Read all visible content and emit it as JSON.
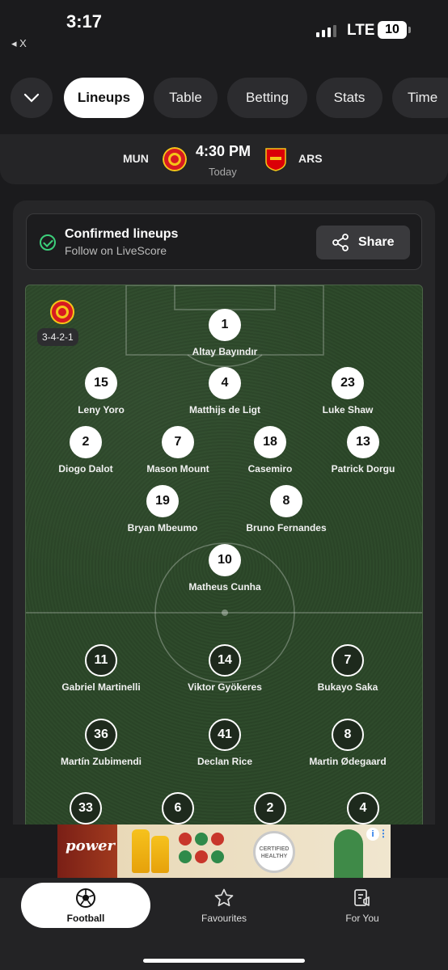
{
  "status_bar": {
    "time": "3:17",
    "back_label": "◂ X",
    "network": "LTE",
    "battery": "10"
  },
  "tabs": [
    {
      "label": "",
      "icon": "chevron-down-icon"
    },
    {
      "label": "Lineups",
      "active": true
    },
    {
      "label": "Table"
    },
    {
      "label": "Betting"
    },
    {
      "label": "Stats"
    },
    {
      "label": "Time"
    }
  ],
  "match": {
    "home": "MUN",
    "away": "ARS",
    "kickoff": "4:30 PM",
    "day": "Today",
    "home_color": "#d71a21",
    "away_color": "#db0007"
  },
  "lineup_banner": {
    "title": "Confirmed lineups",
    "subtitle": "Follow on LiveScore",
    "share_label": "Share",
    "check_color": "#3ccf7a"
  },
  "home_team": {
    "formation": "3-4-2-1",
    "players": [
      {
        "number": "1",
        "name": "Altay Bayındır"
      },
      {
        "number": "15",
        "name": "Leny Yoro"
      },
      {
        "number": "4",
        "name": "Matthijs de Ligt"
      },
      {
        "number": "23",
        "name": "Luke Shaw"
      },
      {
        "number": "2",
        "name": "Diogo Dalot"
      },
      {
        "number": "7",
        "name": "Mason Mount"
      },
      {
        "number": "18",
        "name": "Casemiro"
      },
      {
        "number": "13",
        "name": "Patrick Dorgu"
      },
      {
        "number": "19",
        "name": "Bryan Mbeumo"
      },
      {
        "number": "8",
        "name": "Bruno Fernandes"
      },
      {
        "number": "10",
        "name": "Matheus Cunha"
      }
    ]
  },
  "away_team": {
    "players": [
      {
        "number": "11",
        "name": "Gabriel Martinelli"
      },
      {
        "number": "14",
        "name": "Viktor Gyökeres"
      },
      {
        "number": "7",
        "name": "Bukayo Saka"
      },
      {
        "number": "36",
        "name": "Martín Zubimendi"
      },
      {
        "number": "41",
        "name": "Declan Rice"
      },
      {
        "number": "8",
        "name": "Martin Ødegaard"
      },
      {
        "number": "33",
        "name": ""
      },
      {
        "number": "6",
        "name": ""
      },
      {
        "number": "2",
        "name": ""
      },
      {
        "number": "4",
        "name": ""
      }
    ]
  },
  "ad": {
    "brand": "power",
    "badge": "CERTIFIED HEALTHY"
  },
  "nav": [
    {
      "label": "Football",
      "icon": "football-icon",
      "active": true
    },
    {
      "label": "Favourites",
      "icon": "star-icon"
    },
    {
      "label": "For You",
      "icon": "for-you-icon"
    }
  ]
}
